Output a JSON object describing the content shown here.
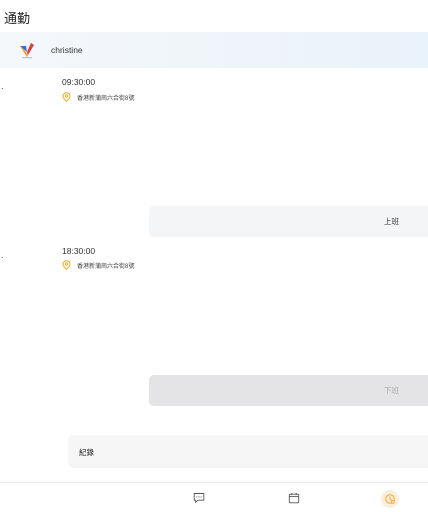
{
  "header": {
    "title": "通勤"
  },
  "user": {
    "name": "christine"
  },
  "clock_in": {
    "marker": ".",
    "time": "09:30:00",
    "location": "香港新蒲崗六合街8號",
    "button_label": "上班"
  },
  "clock_out": {
    "marker": ".",
    "time": "18:30:00",
    "location": "香港新蒲崗六合街8號",
    "button_label": "下班"
  },
  "records": {
    "label": "紀錄"
  },
  "bottom_nav": {
    "items": [
      {
        "icon": "message-icon"
      },
      {
        "icon": "calendar-icon"
      },
      {
        "icon": "checkin-icon",
        "active": true
      }
    ]
  },
  "colors": {
    "accent": "#f5a623",
    "user_bar": "#eef4f9",
    "button_active_bg": "#f4f5f6",
    "button_disabled_bg": "#e4e4e6"
  }
}
